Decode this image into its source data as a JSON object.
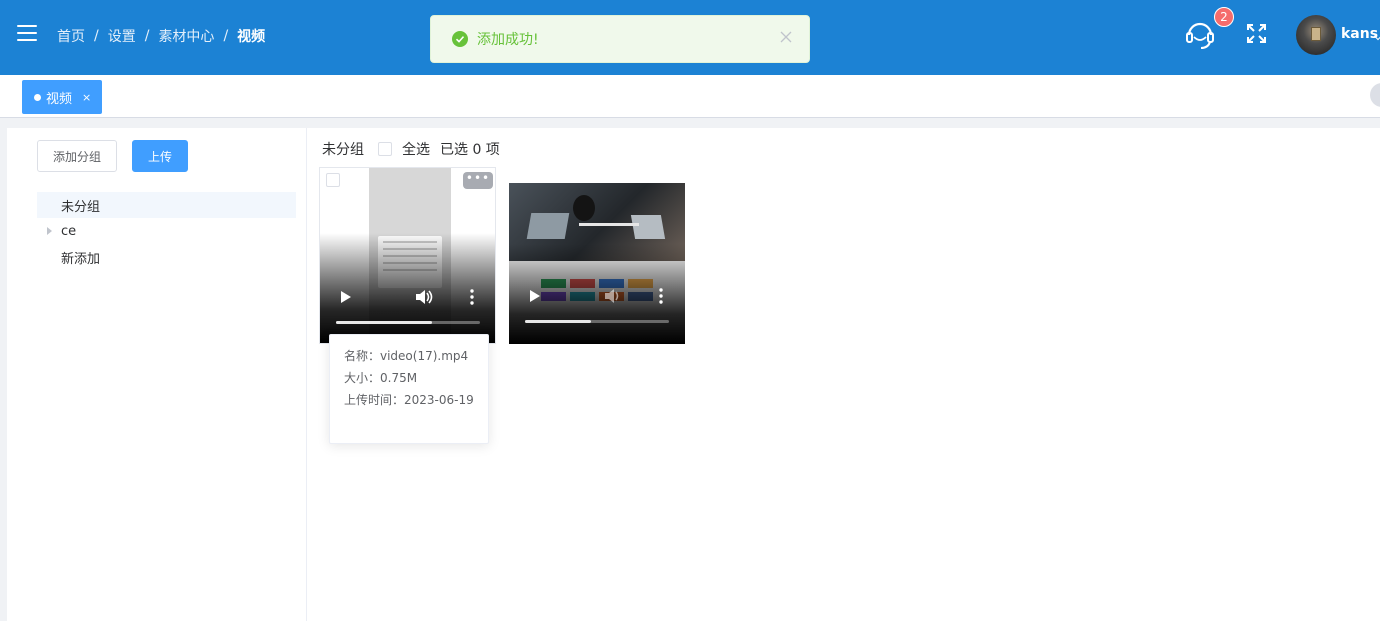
{
  "header": {
    "breadcrumbs": [
      "首页",
      "设置",
      "素材中心",
      "视频"
    ],
    "separator": "/",
    "notification_count": "2",
    "username": "kans",
    "bg_color": "#1c82d4"
  },
  "toast": {
    "message": "添加成功!",
    "type": "success",
    "icon": "check-circle-icon"
  },
  "tags": [
    {
      "label": "视频",
      "close": "×"
    }
  ],
  "sidebar": {
    "add_group_label": "添加分组",
    "upload_label": "上传",
    "groups": [
      {
        "label": "未分组",
        "active": true,
        "expandable": false
      },
      {
        "label": "ce",
        "active": false,
        "expandable": true
      },
      {
        "label": "新添加",
        "active": false,
        "expandable": false
      }
    ]
  },
  "content": {
    "group_title": "未分组",
    "select_all_label": "全选",
    "selected_text": "已选 0 项",
    "more_label": "•••",
    "videos": [
      {
        "progress": 0.67
      },
      {
        "progress": 0.46
      }
    ],
    "tooltip": {
      "name_line": "名称：video(17).mp4",
      "size_line": "大小：0.75M",
      "date_line": "上传时间：2023-06-19"
    }
  }
}
